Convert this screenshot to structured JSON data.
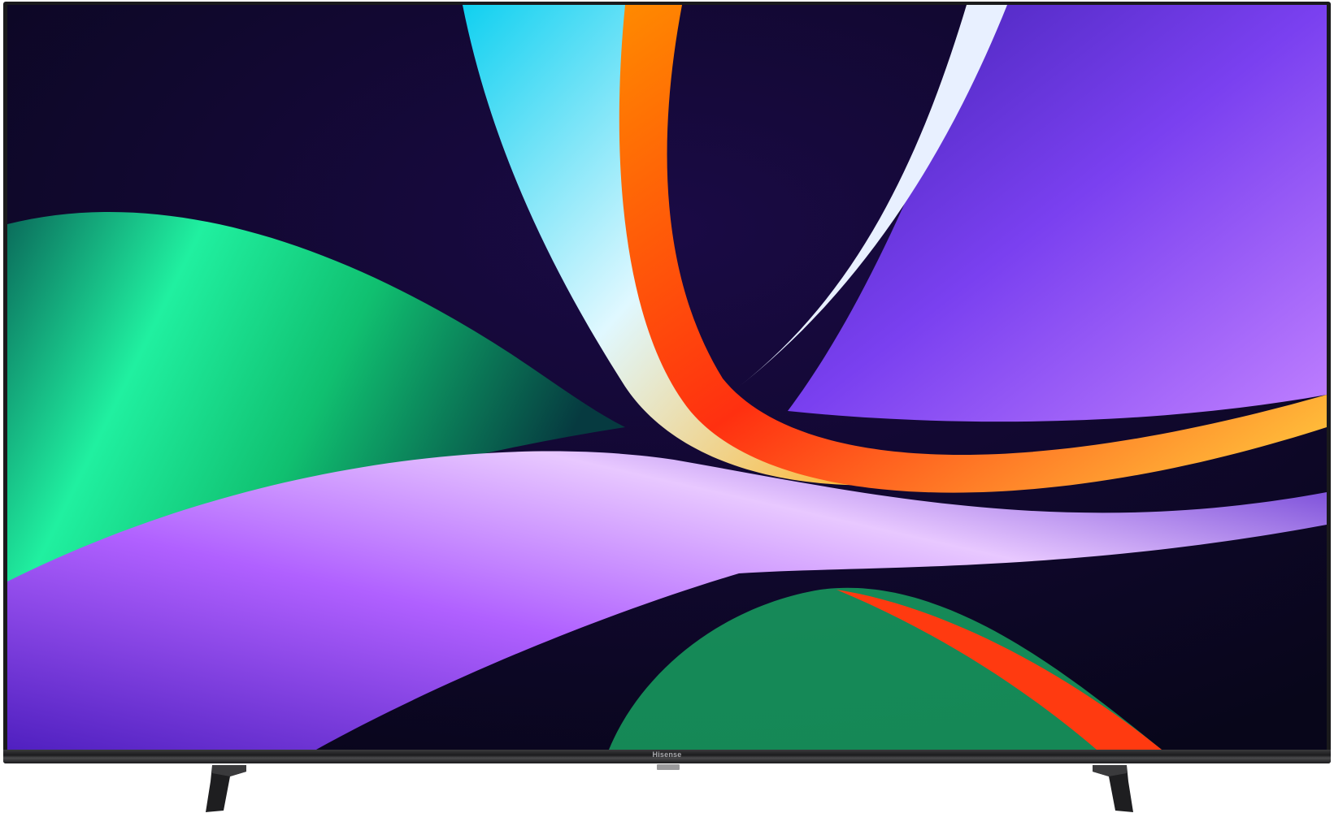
{
  "product": {
    "brand_logo": "Hisense",
    "colors": {
      "bezel": "#1a1a1c",
      "screen_bg": "#120a2e",
      "green": "#19e07a",
      "purple": "#8a2cf0",
      "orange": "#ff5a10",
      "cyan": "#28c8f0"
    }
  }
}
